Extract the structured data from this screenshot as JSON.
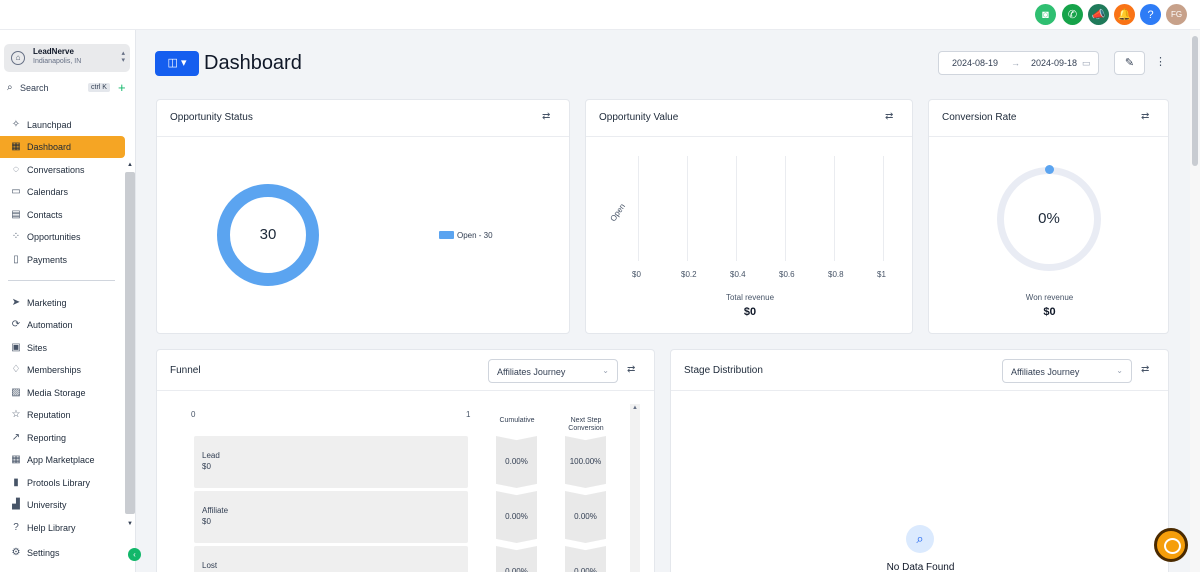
{
  "topbar": {
    "icons": [
      "assistant-icon",
      "phone-icon",
      "megaphone-icon",
      "bell-icon",
      "help-icon"
    ],
    "avatar_initials": "FG"
  },
  "account": {
    "name": "LeadNerve",
    "location": "Indianapolis, IN"
  },
  "search": {
    "label": "Search",
    "shortcut": "ctrl K"
  },
  "sidebar": {
    "items": [
      {
        "label": "Launchpad",
        "icon": "rocket-icon"
      },
      {
        "label": "Dashboard",
        "icon": "grid-icon"
      },
      {
        "label": "Conversations",
        "icon": "chat-icon"
      },
      {
        "label": "Calendars",
        "icon": "calendar-icon"
      },
      {
        "label": "Contacts",
        "icon": "contacts-icon"
      },
      {
        "label": "Opportunities",
        "icon": "opportunities-icon"
      },
      {
        "label": "Payments",
        "icon": "payments-icon"
      },
      {
        "label": "Marketing",
        "icon": "send-icon"
      },
      {
        "label": "Automation",
        "icon": "automation-icon"
      },
      {
        "label": "Sites",
        "icon": "sites-icon"
      },
      {
        "label": "Memberships",
        "icon": "membership-icon"
      },
      {
        "label": "Media Storage",
        "icon": "media-icon"
      },
      {
        "label": "Reputation",
        "icon": "star-icon"
      },
      {
        "label": "Reporting",
        "icon": "chart-line-icon"
      },
      {
        "label": "App Marketplace",
        "icon": "apps-icon"
      },
      {
        "label": "Protools Library",
        "icon": "book-icon"
      },
      {
        "label": "University",
        "icon": "university-icon"
      },
      {
        "label": "Help Library",
        "icon": "question-icon"
      }
    ],
    "settings_label": "Settings",
    "active_index": 1
  },
  "header": {
    "title": "Dashboard",
    "date_start": "2024-08-19",
    "date_end": "2024-09-18"
  },
  "opportunity_status": {
    "title": "Opportunity Status",
    "total": "30",
    "legend": "Open - 30"
  },
  "opportunity_value": {
    "title": "Opportunity Value",
    "category": "Open",
    "ticks": [
      "$0",
      "$0.2",
      "$0.4",
      "$0.6",
      "$0.8",
      "$1"
    ],
    "footer_label": "Total revenue",
    "footer_value": "$0"
  },
  "conversion_rate": {
    "title": "Conversion Rate",
    "value": "0%",
    "footer_label": "Won revenue",
    "footer_value": "$0"
  },
  "funnel": {
    "title": "Funnel",
    "pipeline": "Affiliates Journey",
    "axis_min": "0",
    "axis_max": "1",
    "col_cumulative": "Cumulative",
    "col_next": "Next Step Conversion",
    "rows": [
      {
        "name": "Lead",
        "value": "$0",
        "cumulative": "0.00%",
        "next": "100.00%"
      },
      {
        "name": "Affiliate",
        "value": "$0",
        "cumulative": "0.00%",
        "next": "0.00%"
      },
      {
        "name": "Lost",
        "value": "",
        "cumulative": "0.00%",
        "next": "0.00%"
      }
    ]
  },
  "stage_distribution": {
    "title": "Stage Distribution",
    "pipeline": "Affiliates Journey",
    "empty_text": "No Data Found"
  },
  "colors": {
    "accent": "#155eef",
    "active_nav": "#f5a524",
    "donut": "#5ba4f0"
  }
}
